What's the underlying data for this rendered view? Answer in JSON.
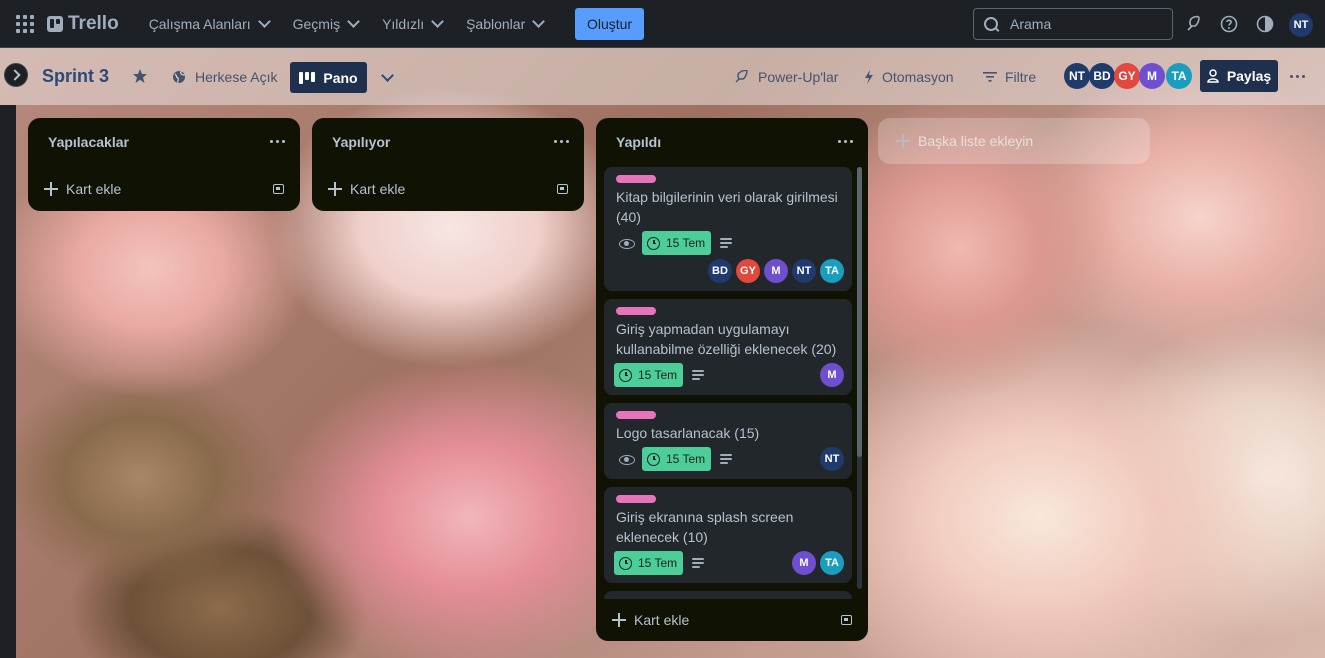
{
  "topbar": {
    "app_name": "Trello",
    "nav": [
      "Çalışma Alanları",
      "Geçmiş",
      "Yıldızlı",
      "Şablonlar"
    ],
    "create_label": "Oluştur",
    "search_placeholder": "Arama",
    "user_initials": "NT"
  },
  "board": {
    "title": "Sprint 3",
    "visibility": "Herkese Açık",
    "view": "Pano",
    "power_ups": "Power-Up'lar",
    "automation": "Otomasyon",
    "filter": "Filtre",
    "share": "Paylaş",
    "members": [
      {
        "initials": "NT",
        "color": "#1f3a6b"
      },
      {
        "initials": "BD",
        "color": "#1f3a6b"
      },
      {
        "initials": "GY",
        "color": "#e2483d"
      },
      {
        "initials": "M",
        "color": "#6e4fcf"
      },
      {
        "initials": "TA",
        "color": "#1a9ec0"
      }
    ]
  },
  "lists": [
    {
      "title": "Yapılacaklar",
      "add_card": "Kart ekle"
    },
    {
      "title": "Yapılıyor",
      "add_card": "Kart ekle"
    },
    {
      "title": "Yapıldı",
      "add_card": "Kart ekle"
    }
  ],
  "add_list": "Başka liste ekleyin",
  "cards": [
    {
      "title_1": "Kitap bilgilerinin veri olarak girilmesi",
      "title_2": "(40)",
      "due": "15 Tem",
      "members": [
        "BD",
        "GY",
        "M",
        "NT",
        "TA"
      ]
    },
    {
      "title_1": "Giriş yapmadan uygulamayı",
      "title_2": "kullanabilme özelliği eklenecek (20)",
      "due": "15 Tem",
      "members": [
        "M"
      ]
    },
    {
      "title_1": "Logo tasarlanacak (15)",
      "due": "15 Tem",
      "members": [
        "NT"
      ]
    },
    {
      "title_1": "Giriş ekranına splash screen",
      "title_2": "eklenecek (10)",
      "due": "15 Tem",
      "members": [
        "M",
        "TA"
      ]
    }
  ],
  "colors": {
    "label": "#e774bb",
    "due_complete": "#4bce97",
    "accent": "#579dff"
  }
}
